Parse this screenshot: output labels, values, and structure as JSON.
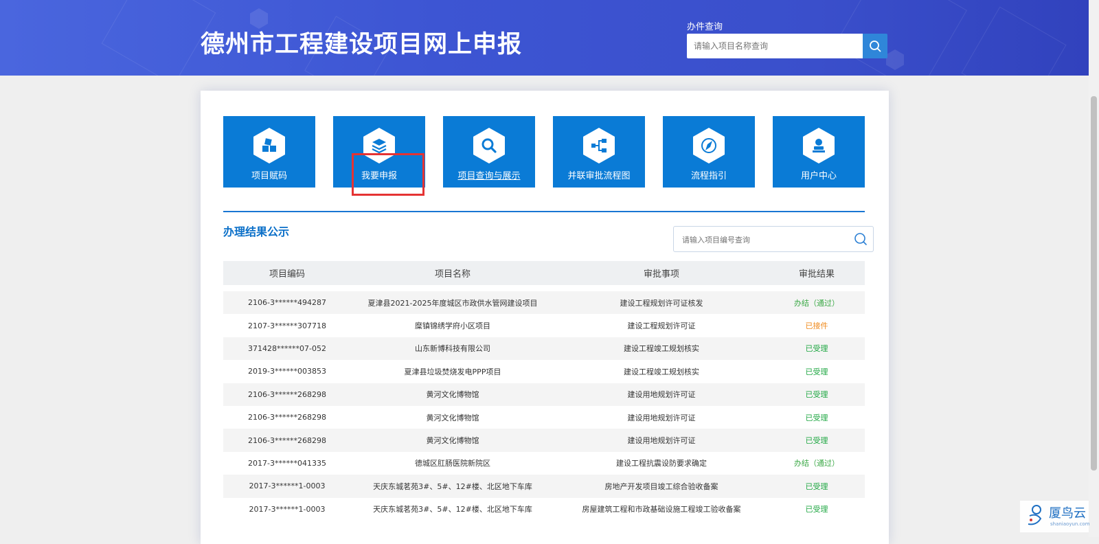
{
  "header": {
    "title": "德州市工程建设项目网上申报",
    "query_label": "办件查询",
    "query_placeholder": "请输入项目名称查询"
  },
  "nav_tiles": [
    {
      "label": "项目赋码",
      "icon": "cubes-icon"
    },
    {
      "label": "我要申报",
      "icon": "layers-icon"
    },
    {
      "label": "项目查询与展示",
      "icon": "search-icon"
    },
    {
      "label": "并联审批流程图",
      "icon": "flowchart-icon"
    },
    {
      "label": "流程指引",
      "icon": "compass-icon"
    },
    {
      "label": "用户中心",
      "icon": "user-stamp-icon"
    }
  ],
  "results": {
    "title": "办理结果公示",
    "search_placeholder": "请输入项目编号查询",
    "columns": [
      "项目编码",
      "项目名称",
      "审批事项",
      "审批结果"
    ],
    "rows": [
      {
        "code": "2106-3******494287",
        "name": "夏津县2021-2025年度城区市政供水管网建设项目",
        "item": "建设工程规划许可证核发",
        "result": "办结（通过）"
      },
      {
        "code": "2107-3******307718",
        "name": "糜镇锦绣学府小区项目",
        "item": "建设工程规划许可证",
        "result": "已接件"
      },
      {
        "code": "371428******07-052",
        "name": "山东新博科技有限公司",
        "item": "建设工程竣工规划核实",
        "result": "已受理"
      },
      {
        "code": "2019-3******003853",
        "name": "夏津县垃圾焚烧发电PPP项目",
        "item": "建设工程竣工规划核实",
        "result": "已受理"
      },
      {
        "code": "2106-3******268298",
        "name": "黄河文化博物馆",
        "item": "建设用地规划许可证",
        "result": "已受理"
      },
      {
        "code": "2106-3******268298",
        "name": "黄河文化博物馆",
        "item": "建设用地规划许可证",
        "result": "已受理"
      },
      {
        "code": "2106-3******268298",
        "name": "黄河文化博物馆",
        "item": "建设用地规划许可证",
        "result": "已受理"
      },
      {
        "code": "2017-3******041335",
        "name": "德城区肛肠医院新院区",
        "item": "建设工程抗震设防要求确定",
        "result": "办结（通过）"
      },
      {
        "code": "2017-3******1-0003",
        "name": "天庆东城茗苑3#、5#、12#楼、北区地下车库",
        "item": "房地产开发项目竣工综合验收备案",
        "result": "已受理"
      },
      {
        "code": "2017-3******1-0003",
        "name": "天庆东城茗苑3#、5#、12#楼、北区地下车库",
        "item": "房屋建筑工程和市政基础设施工程竣工验收备案",
        "result": "已受理"
      }
    ]
  },
  "status_colors": {
    "办结（通过）": "#3aa845",
    "已接件": "#f08a1c",
    "已受理": "#22a845"
  },
  "watermark": {
    "text": "厦鸟云",
    "sub": "shaniaoyun.com"
  }
}
